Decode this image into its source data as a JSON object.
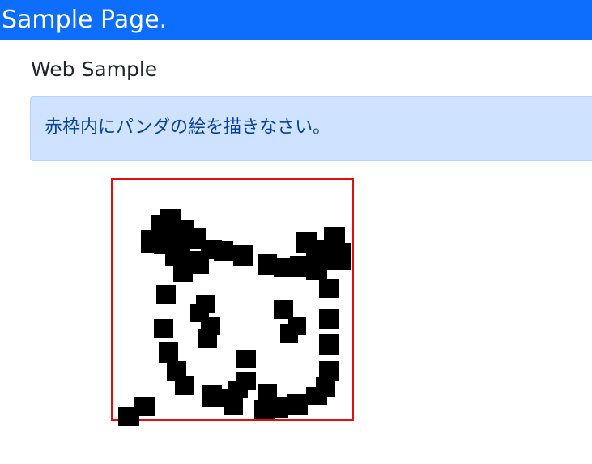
{
  "navbar": {
    "brand": "Sample Page."
  },
  "page": {
    "heading": "Web Sample"
  },
  "alert": {
    "text": "赤枠内にパンダの絵を描きなさい。",
    "background": "#cfe2ff",
    "text_color": "#084298"
  },
  "canvas": {
    "border_color": "#e01010",
    "ink_color": "#000000"
  },
  "colors": {
    "navbar": "#0d6efd"
  }
}
